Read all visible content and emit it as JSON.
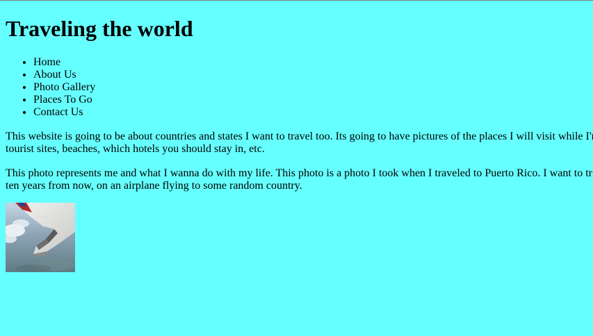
{
  "page": {
    "title": "Traveling the world",
    "background_color": "#66ffff"
  },
  "nav": {
    "items": [
      {
        "label": "Home"
      },
      {
        "label": "About Us"
      },
      {
        "label": "Photo Gallery"
      },
      {
        "label": "Places To Go"
      },
      {
        "label": "Contact Us"
      }
    ]
  },
  "content": {
    "paragraph1_line1": "This website is going to be about countries and states I want to travel too. Its going to have pictures of the places I will visit while I'm",
    "paragraph1_line2": "tourist sites, beaches, which hotels you should stay in, etc.",
    "paragraph2_line1": "This photo represents me and what I wanna do with my life. This photo is a photo I took when I traveled to Puerto Rico. I want to tr",
    "paragraph2_line2": "ten years from now, on an airplane flying to some random country."
  },
  "image": {
    "subject": "airplane wing over clouds photo"
  }
}
